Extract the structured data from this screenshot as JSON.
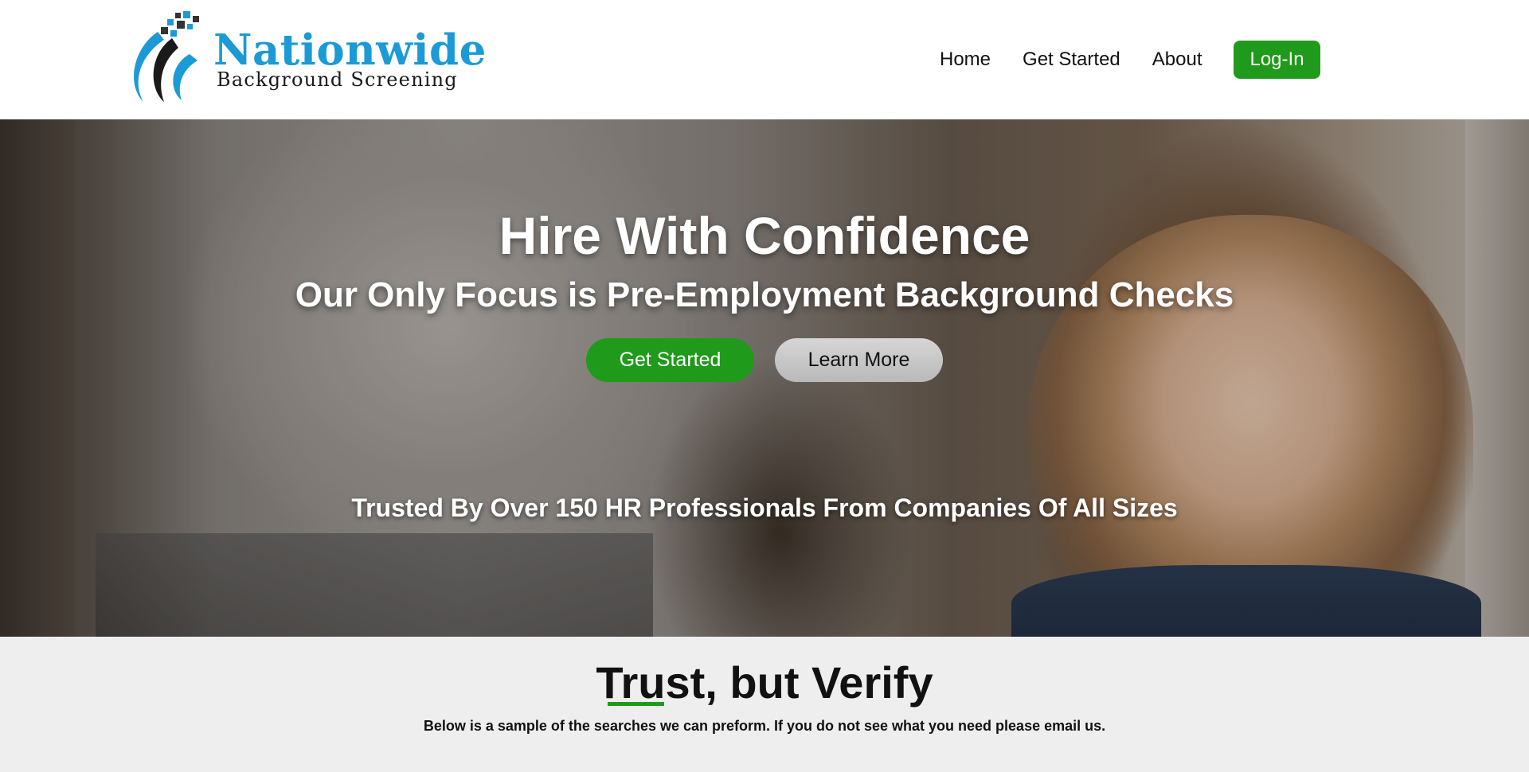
{
  "brand": {
    "name": "Nationwide",
    "tagline": "Background Screening",
    "color": "#1b9ad6"
  },
  "nav": {
    "items": [
      {
        "label": "Home"
      },
      {
        "label": "Get Started"
      },
      {
        "label": "About"
      }
    ],
    "login_label": "Log-In",
    "accent": "#1f9a1a"
  },
  "hero": {
    "title": "Hire With Confidence",
    "subtitle": "Our Only Focus is Pre-Employment Background Checks",
    "primary_button": "Get Started",
    "secondary_button": "Learn More",
    "trusted_text": "Trusted By Over 150 HR Professionals From Companies Of All Sizes"
  },
  "section": {
    "title": "Trust, but Verify",
    "description": "Below is a sample of the searches we can preform. If you do not see what you need please email us."
  }
}
